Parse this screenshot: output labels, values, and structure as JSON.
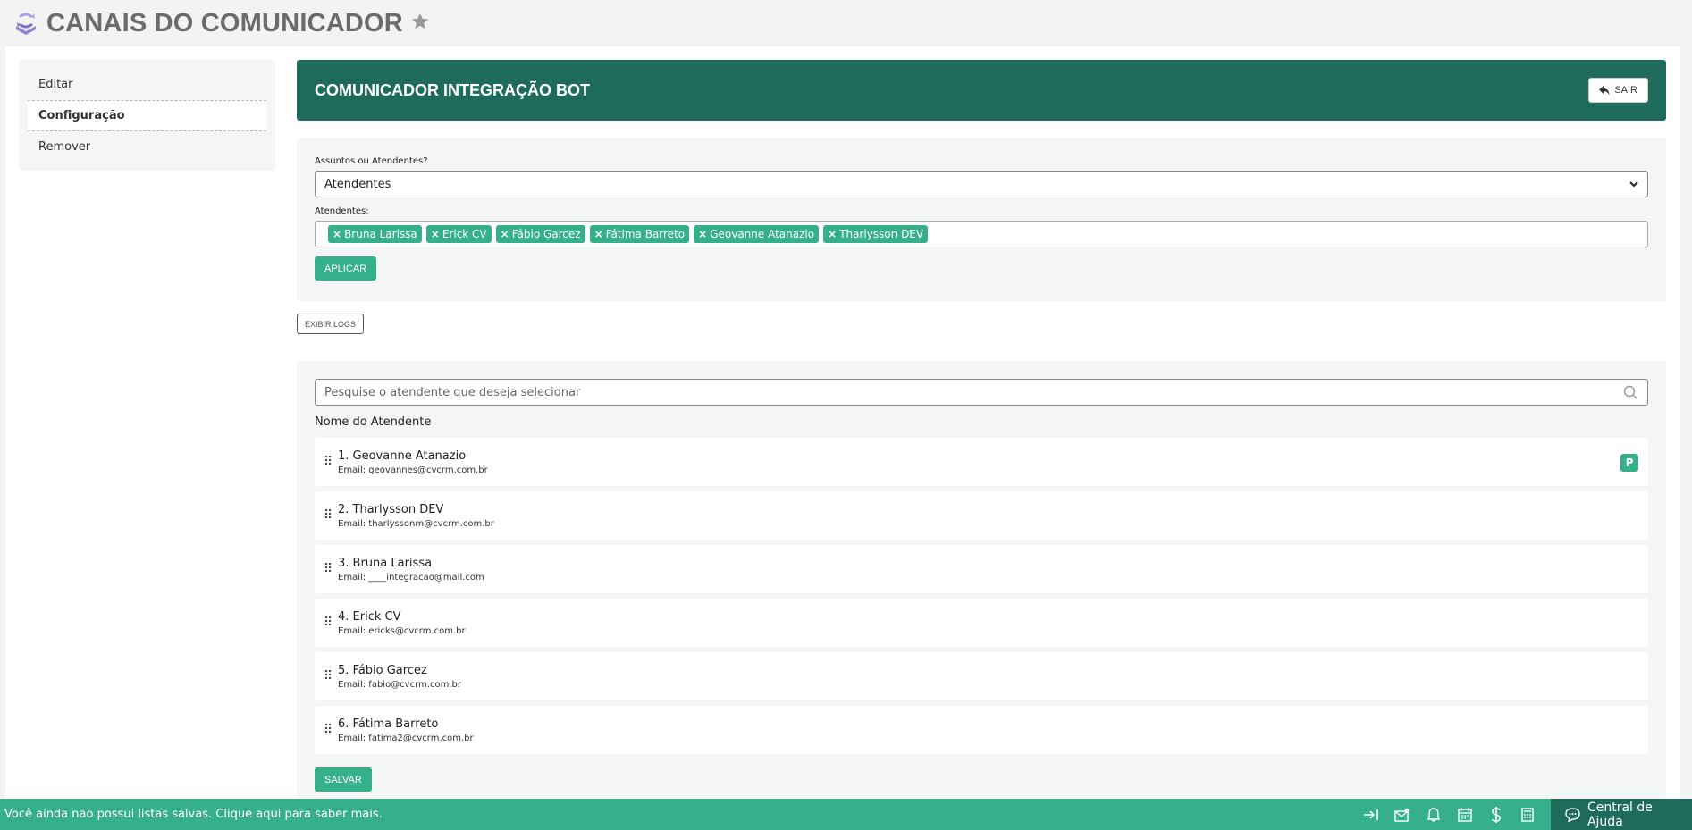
{
  "page": {
    "title": "CANAIS DO COMUNICADOR"
  },
  "side_menu": {
    "items": [
      {
        "label": "Editar"
      },
      {
        "label": "Configuração"
      },
      {
        "label": "Remover"
      }
    ]
  },
  "bot_header": {
    "title": "COMUNICADOR INTEGRAÇÃO BOT",
    "exit_label": "SAIR"
  },
  "config": {
    "type_label": "Assuntos ou Atendentes?",
    "type_value": "Atendentes",
    "attendants_label": "Atendentes:",
    "tags": [
      "Bruna Larissa",
      "Erick CV",
      "Fábio Garcez",
      "Fátima Barreto",
      "Geovanne Atanazio",
      "Tharlysson DEV"
    ],
    "apply_label": "APLICAR"
  },
  "logs_button": "EXIBIR LOGS",
  "attendant_list": {
    "search_placeholder": "Pesquise o atendente que deseja selecionar",
    "heading": "Nome do Atendente",
    "items": [
      {
        "name": "1. Geovanne Atanazio",
        "email": "Email: geovannes@cvcrm.com.br",
        "badge": "P"
      },
      {
        "name": "2. Tharlysson DEV",
        "email": "Email: tharlyssonm@cvcrm.com.br"
      },
      {
        "name": "3. Bruna Larissa",
        "email": "Email: ____integracao@mail.com"
      },
      {
        "name": "4. Erick CV",
        "email": "Email: ericks@cvcrm.com.br"
      },
      {
        "name": "5. Fábio Garcez",
        "email": "Email: fabio@cvcrm.com.br"
      },
      {
        "name": "6. Fátima Barreto",
        "email": "Email: fatima2@cvcrm.com.br"
      }
    ],
    "save_label": "SALVAR"
  },
  "footer": {
    "message": "Você ainda não possui listas salvas. Clique aqui para saber mais.",
    "help_label": "Central de Ajuda"
  },
  "colors": {
    "primary": "#36b08a",
    "dark_primary": "#1e6b5c",
    "panel": "#f4f5f6"
  },
  "icons": [
    "logo-icon",
    "star-icon",
    "reply-icon",
    "chevron-down-icon",
    "search-icon",
    "drag-handle-icon",
    "collapse-icon",
    "mail-star-icon",
    "bell-icon",
    "calendar-icon",
    "dollar-icon",
    "calculator-icon",
    "chat-icon"
  ]
}
